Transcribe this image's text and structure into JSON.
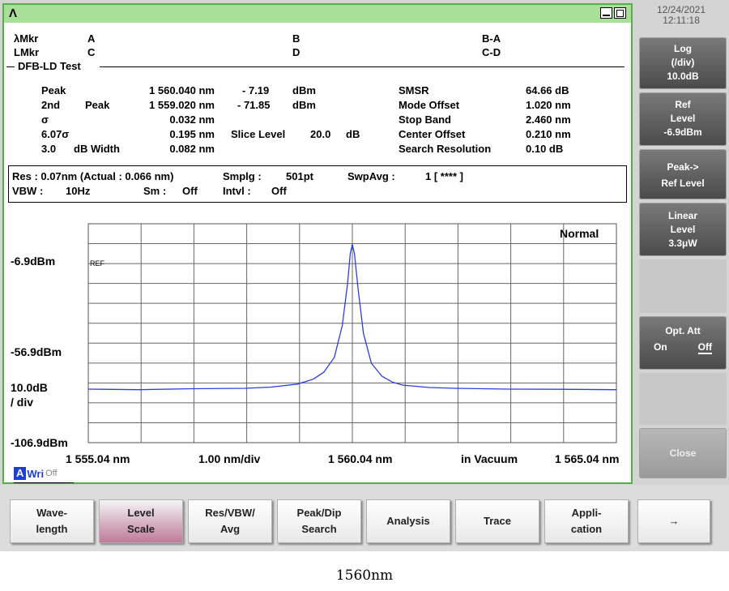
{
  "header": {
    "logo": "Λ",
    "datetime": {
      "date": "12/24/2021",
      "time": "12:11:18"
    }
  },
  "markers": {
    "lambda_mkr": "λMkr",
    "l_mkr": "LMkr",
    "a": "A",
    "b": "B",
    "c": "C",
    "d": "D",
    "ba": "B-A",
    "cd": "C-D"
  },
  "test": {
    "title": "DFB-LD Test",
    "left": [
      {
        "label": "Peak",
        "label2": "",
        "value": "1 560.040 nm"
      },
      {
        "label": "2nd",
        "label2": "Peak",
        "value": "1 559.020 nm"
      },
      {
        "label": "σ",
        "label2": "",
        "value": "0.032 nm"
      },
      {
        "label": "6.07σ",
        "label2": "",
        "value": "0.195 nm"
      },
      {
        "label": "3.0",
        "label2": "dB Width",
        "value": "0.082 nm"
      }
    ],
    "mid": {
      "peak_level": "- 7.19",
      "peak_unit": "dBm",
      "peak2_level": "- 71.85",
      "peak2_unit": "dBm",
      "slice_label": "Slice Level",
      "slice_value": "20.0",
      "slice_unit": "dB"
    },
    "right": [
      {
        "label": "SMSR",
        "value": "64.66 dB"
      },
      {
        "label": "Mode Offset",
        "value": "1.020 nm"
      },
      {
        "label": "Stop Band",
        "value": "2.460 nm"
      },
      {
        "label": "Center Offset",
        "value": "0.210 nm"
      },
      {
        "label": "Search Resolution",
        "value": "0.10  dB"
      }
    ]
  },
  "settings": {
    "res": "Res : 0.07nm (Actual : 0.066 nm)",
    "smplg_label": "Smplg :",
    "smplg_value": "501pt",
    "swpavg_label": "SwpAvg :",
    "swpavg_value": "1 [    **** ]",
    "vbw_label": "VBW :",
    "vbw_value": "10Hz",
    "sm_label": "Sm :",
    "sm_value": "Off",
    "intvl_label": "Intvl :",
    "intvl_value": "Off"
  },
  "chart_data": {
    "type": "line",
    "mode_label": "Normal",
    "ref_marker": "REF",
    "y_labels": {
      "top": "-6.9dBm",
      "mid": "-56.9dBm",
      "scale": "10.0dB",
      "scale2": "/ div",
      "bottom": "-106.9dBm"
    },
    "x_labels": {
      "start": "1 555.04 nm",
      "div": "1.00 nm/div",
      "center": "1 560.04 nm",
      "medium": "in Vacuum",
      "stop": "1 565.04 nm"
    },
    "xlim": [
      1555.04,
      1565.04
    ],
    "ylim": [
      -106.9,
      3.1
    ],
    "line_color": "#2a3fe0",
    "series": [
      {
        "x": [
          1555.04,
          1556.0,
          1557.0,
          1558.0,
          1558.5,
          1559.0,
          1559.3,
          1559.5,
          1559.7,
          1559.85,
          1559.95,
          1560.0,
          1560.04,
          1560.08,
          1560.15,
          1560.25,
          1560.4,
          1560.6,
          1560.8,
          1561.0,
          1561.5,
          1562.0,
          1563.0,
          1564.0,
          1565.04
        ],
        "y": [
          -80.0,
          -80.3,
          -79.8,
          -79.6,
          -79.0,
          -77.5,
          -75.0,
          -71.5,
          -64.0,
          -48.0,
          -27.0,
          -12.0,
          -7.2,
          -12.0,
          -30.0,
          -52.0,
          -67.0,
          -73.5,
          -76.5,
          -78.0,
          -79.2,
          -79.6,
          -80.0,
          -80.1,
          -80.3
        ]
      }
    ]
  },
  "status": {
    "a": "A",
    "wri": "Wri",
    "off": "Off"
  },
  "softkeys": {
    "log": [
      "Log",
      "(/div)",
      "10.0dB"
    ],
    "ref": [
      "Ref",
      "Level",
      "-6.9dBm"
    ],
    "peak": [
      "Peak->",
      "Ref Level"
    ],
    "linear": [
      "Linear",
      "Level",
      "3.3μW"
    ],
    "opt_att": "Opt. Att",
    "opt_on": "On",
    "opt_off": "Off",
    "close": "Close"
  },
  "bottom_keys": [
    [
      "Wave-",
      "length"
    ],
    [
      "Level",
      "Scale"
    ],
    [
      "Res/VBW/",
      "Avg"
    ],
    [
      "Peak/Dip",
      "Search"
    ],
    [
      "Analysis"
    ],
    [
      "Trace"
    ],
    [
      "Appli-",
      "cation"
    ],
    [
      "→"
    ]
  ],
  "caption": "1560nm"
}
